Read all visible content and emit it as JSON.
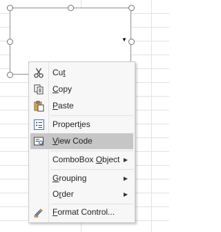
{
  "combo_box": {
    "dropdown_glyph": "▼"
  },
  "context_menu": {
    "items": [
      {
        "label": "Cut",
        "icon": "scissors-icon",
        "underline": "t"
      },
      {
        "label": "Copy",
        "icon": "copy-icon",
        "underline": "C"
      },
      {
        "label": "Paste",
        "icon": "paste-icon",
        "underline": "P"
      },
      {
        "label": "Properties",
        "icon": "properties-icon",
        "underline": "i"
      },
      {
        "label": "View Code",
        "icon": "view-code-icon",
        "underline": "V",
        "highlighted": true
      },
      {
        "label": "ComboBox Object",
        "icon": "",
        "underline": "O",
        "submenu": true
      },
      {
        "label": "Grouping",
        "icon": "",
        "underline": "G",
        "submenu": true
      },
      {
        "label": "Order",
        "icon": "",
        "underline": "r",
        "submenu": true
      },
      {
        "label": "Format Control...",
        "icon": "format-control-icon",
        "underline": "F"
      }
    ],
    "submenu_glyph": "▶"
  },
  "colors": {
    "highlight": "#c6c6c6",
    "menu_background": "#f7f7f7",
    "grid_line": "#e1e1e1"
  }
}
